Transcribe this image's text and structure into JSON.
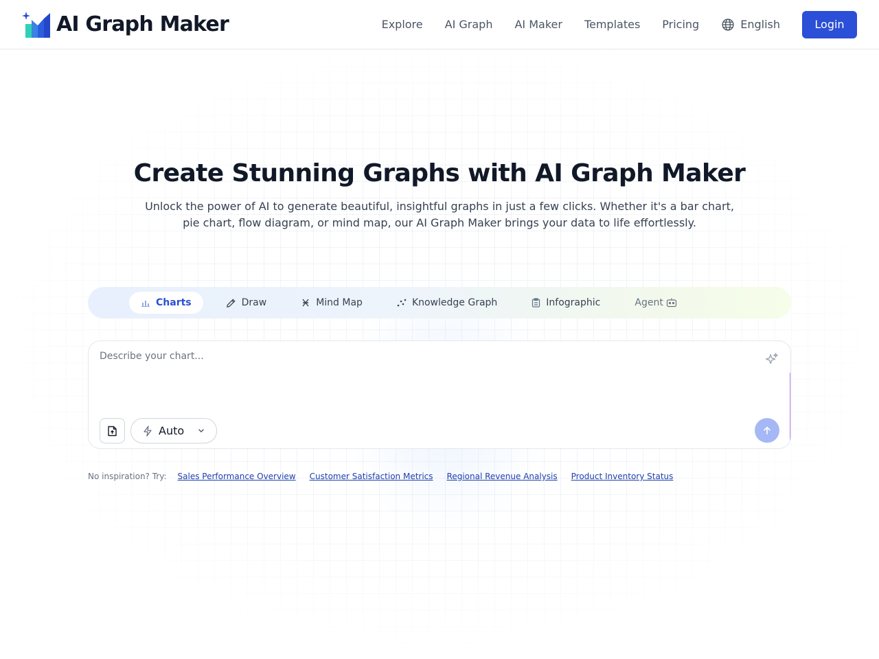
{
  "header": {
    "brand_name": "AI Graph Maker",
    "nav": [
      "Explore",
      "AI Graph",
      "AI Maker",
      "Templates",
      "Pricing"
    ],
    "language": "English",
    "login_label": "Login"
  },
  "hero": {
    "title": "Create Stunning Graphs with AI Graph Maker",
    "subtitle": "Unlock the power of AI to generate beautiful, insightful graphs in just a few clicks. Whether it's a bar chart, pie chart, flow diagram, or mind map, our AI Graph Maker brings your data to life effortlessly."
  },
  "tabs": [
    {
      "label": "Charts",
      "icon": "bar-chart-icon",
      "active": true
    },
    {
      "label": "Draw",
      "icon": "pencil-icon",
      "active": false
    },
    {
      "label": "Mind Map",
      "icon": "mind-map-icon",
      "active": false
    },
    {
      "label": "Knowledge Graph",
      "icon": "scatter-icon",
      "active": false
    },
    {
      "label": "Infographic",
      "icon": "clipboard-icon",
      "active": false
    },
    {
      "label": "Agent",
      "icon": "robot-icon",
      "active": false
    }
  ],
  "prompt": {
    "placeholder": "Describe your chart...",
    "value": "",
    "mode": "Auto"
  },
  "suggestions": {
    "label": "No inspiration? Try:",
    "items": [
      "Sales Performance Overview",
      "Customer Satisfaction Metrics",
      "Regional Revenue Analysis",
      "Product Inventory Status"
    ]
  },
  "colors": {
    "accent": "#2b4fd6",
    "send_disabled": "#a5b8f5",
    "link": "#1e40af"
  }
}
